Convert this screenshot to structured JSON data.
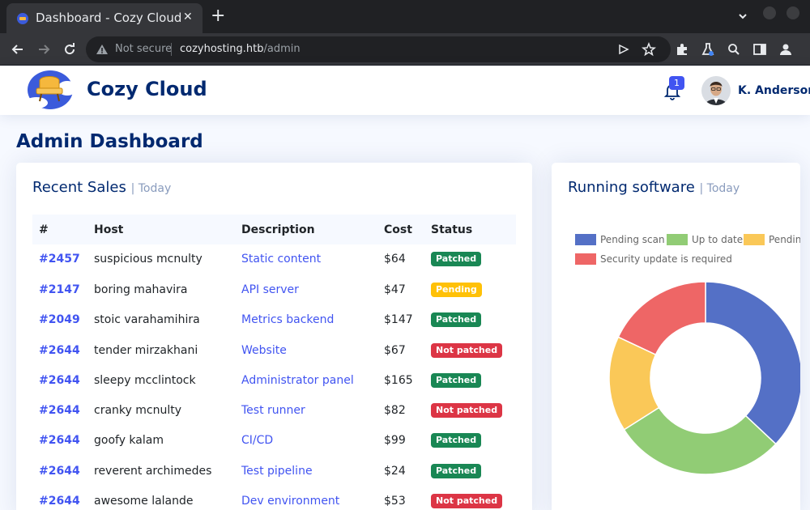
{
  "browser": {
    "tab_title": "Dashboard - Cozy Cloud",
    "security_label": "Not secure",
    "url_host": "cozyhosting.htb",
    "url_path": "/admin"
  },
  "header": {
    "brand": "Cozy Cloud",
    "notification_count": "1",
    "user_name": "K. Anderson"
  },
  "page_title": "Admin Dashboard",
  "recent_sales": {
    "title": "Recent Sales",
    "subtitle": "| Today",
    "columns": [
      "#",
      "Host",
      "Description",
      "Cost",
      "Status"
    ],
    "rows": [
      {
        "id": "#2457",
        "host": "suspicious mcnulty",
        "description": "Static content",
        "cost": "$64",
        "status": "Patched"
      },
      {
        "id": "#2147",
        "host": "boring mahavira",
        "description": "API server",
        "cost": "$47",
        "status": "Pending"
      },
      {
        "id": "#2049",
        "host": "stoic varahamihira",
        "description": "Metrics backend",
        "cost": "$147",
        "status": "Patched"
      },
      {
        "id": "#2644",
        "host": "tender mirzakhani",
        "description": "Website",
        "cost": "$67",
        "status": "Not patched"
      },
      {
        "id": "#2644",
        "host": "sleepy mcclintock",
        "description": "Administrator panel",
        "cost": "$165",
        "status": "Patched"
      },
      {
        "id": "#2644",
        "host": "cranky mcnulty",
        "description": "Test runner",
        "cost": "$82",
        "status": "Not patched"
      },
      {
        "id": "#2644",
        "host": "goofy kalam",
        "description": "CI/CD",
        "cost": "$99",
        "status": "Patched"
      },
      {
        "id": "#2644",
        "host": "reverent archimedes",
        "description": "Test pipeline",
        "cost": "$24",
        "status": "Patched"
      },
      {
        "id": "#2644",
        "host": "awesome lalande",
        "description": "Dev environment",
        "cost": "$53",
        "status": "Not patched"
      }
    ]
  },
  "running_software": {
    "title": "Running software",
    "subtitle": "| Today"
  },
  "chart_data": {
    "type": "pie",
    "donut": true,
    "series": [
      {
        "name": "Pending scan",
        "value": 37,
        "color": "#5470c6"
      },
      {
        "name": "Up to date",
        "value": 29,
        "color": "#91cc75"
      },
      {
        "name": "Pending u",
        "value": 16,
        "color": "#fac858"
      },
      {
        "name": "Security update is required",
        "value": 18,
        "color": "#ee6666"
      }
    ],
    "legend_position": "top"
  },
  "colors": {
    "brand": "#012970",
    "accent": "#4154f1",
    "patched": "#198754",
    "pending": "#ffc107",
    "not_patched": "#dc3545"
  }
}
